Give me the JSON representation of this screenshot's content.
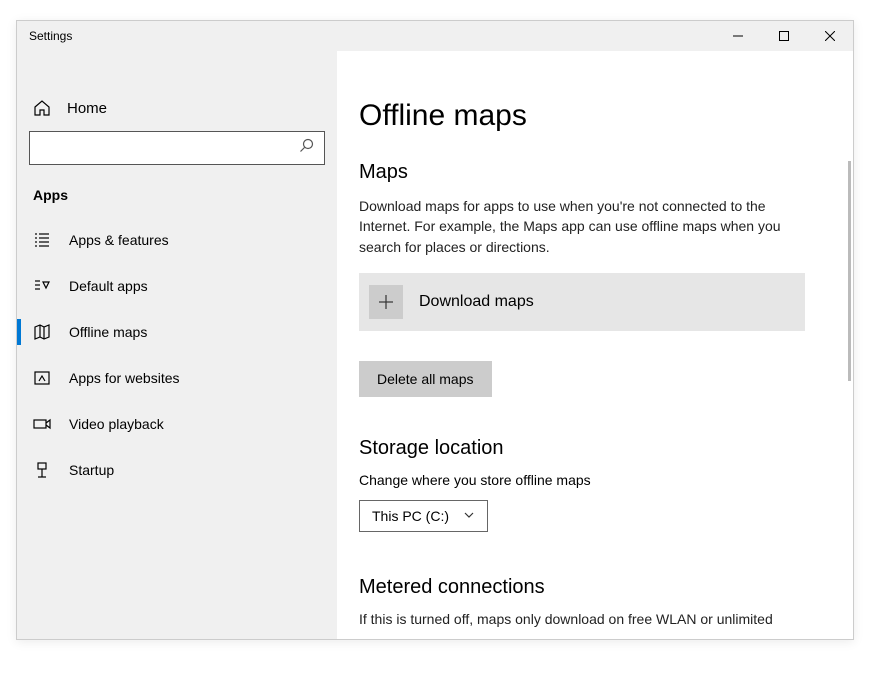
{
  "window": {
    "title": "Settings"
  },
  "sidebar": {
    "home": "Home",
    "search_placeholder": "",
    "section": "Apps",
    "items": [
      {
        "label": "Apps & features"
      },
      {
        "label": "Default apps"
      },
      {
        "label": "Offline maps"
      },
      {
        "label": "Apps for websites"
      },
      {
        "label": "Video playback"
      },
      {
        "label": "Startup"
      }
    ]
  },
  "main": {
    "title": "Offline maps",
    "section_maps": "Maps",
    "maps_desc": "Download maps for apps to use when you're not connected to the Internet. For example, the Maps app can use offline maps when you search for places or directions.",
    "download_label": "Download maps",
    "delete_label": "Delete all maps",
    "section_storage": "Storage location",
    "storage_desc": "Change where you store offline maps",
    "storage_value": "This PC (C:)",
    "section_metered": "Metered connections",
    "metered_desc": "If this is turned off, maps only download on free WLAN or unlimited"
  }
}
